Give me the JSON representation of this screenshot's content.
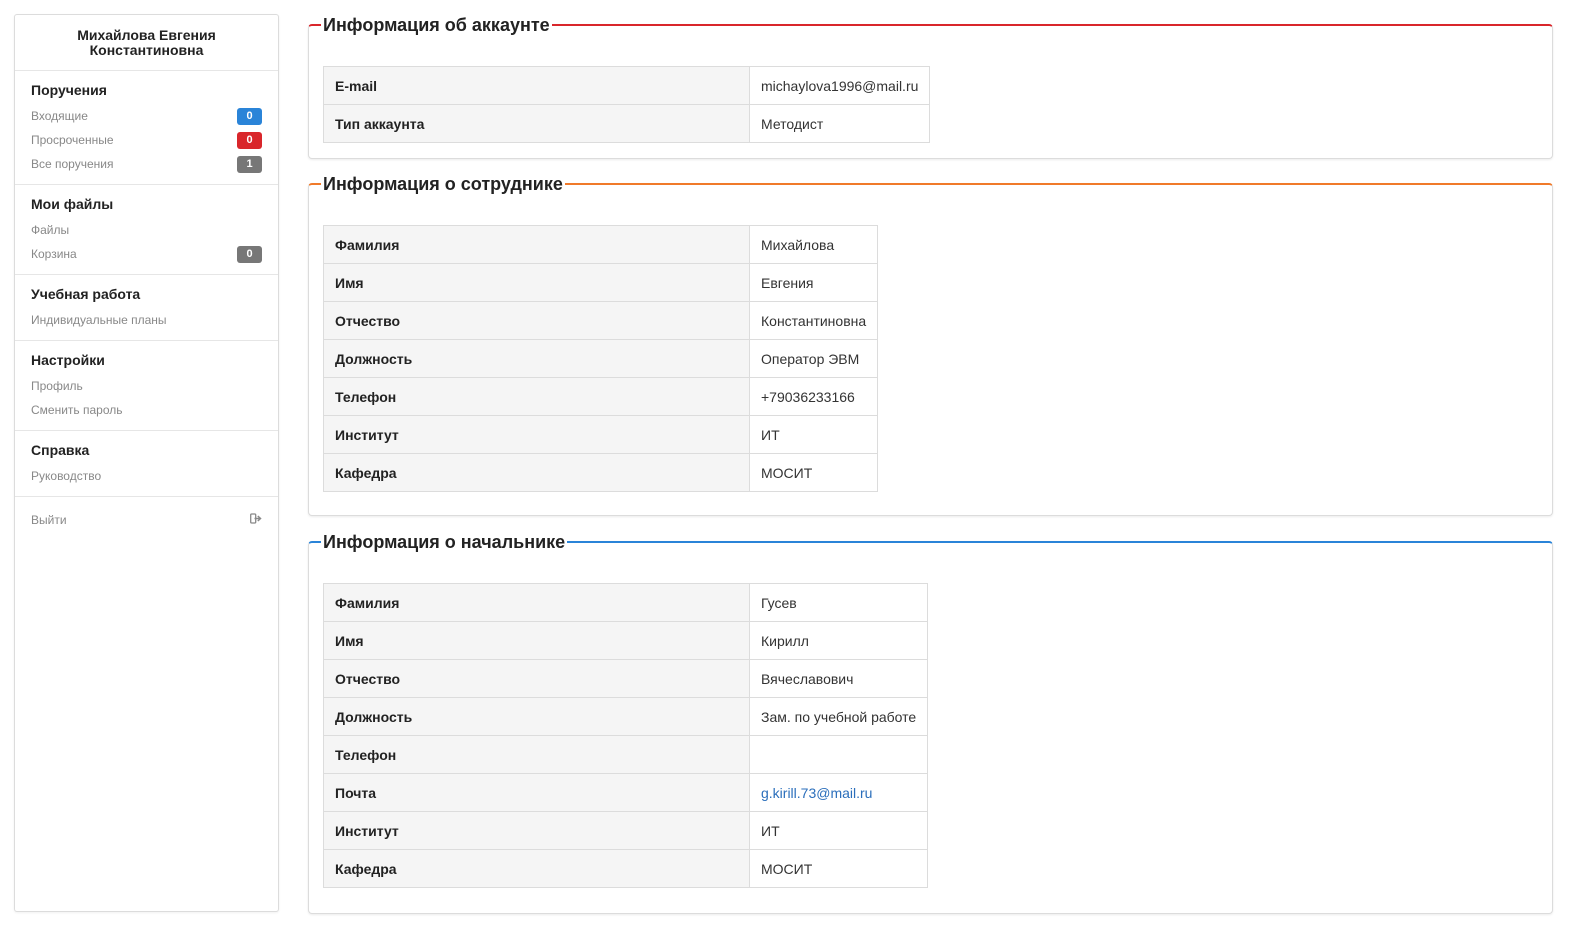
{
  "user": {
    "name_line1": "Михайлова Евгения",
    "name_line2": "Константиновна"
  },
  "sidebar": {
    "sections": [
      {
        "title": "Поручения",
        "items": [
          {
            "label": "Входящие",
            "badge": "0",
            "badge_color": "#2a84d8"
          },
          {
            "label": "Просроченные",
            "badge": "0",
            "badge_color": "#d9262b"
          },
          {
            "label": "Все поручения",
            "badge": "1",
            "badge_color": "#777777"
          }
        ]
      },
      {
        "title": "Мои файлы",
        "items": [
          {
            "label": "Файлы"
          },
          {
            "label": "Корзина",
            "badge": "0",
            "badge_color": "#777777"
          }
        ]
      },
      {
        "title": "Учебная работа",
        "items": [
          {
            "label": "Индивидуальные планы"
          }
        ]
      },
      {
        "title": "Настройки",
        "items": [
          {
            "label": "Профиль"
          },
          {
            "label": "Сменить пароль"
          }
        ]
      },
      {
        "title": "Справка",
        "items": [
          {
            "label": "Руководство"
          }
        ]
      }
    ],
    "logout": {
      "label": "Выйти",
      "icon": "sign-out-icon"
    }
  },
  "panels": {
    "account": {
      "title": "Информация об аккаунте",
      "accent": "#d9262b",
      "rows": [
        {
          "label": "E-mail",
          "value": "michaylova1996@mail.ru"
        },
        {
          "label": "Тип аккаунта",
          "value": "Методист"
        }
      ]
    },
    "employee": {
      "title": "Информация о сотруднике",
      "accent": "#f07a2a",
      "rows": [
        {
          "label": "Фамилия",
          "value": "Михайлова"
        },
        {
          "label": "Имя",
          "value": "Евгения"
        },
        {
          "label": "Отчество",
          "value": "Константиновна"
        },
        {
          "label": "Должность",
          "value": "Оператор ЭВМ"
        },
        {
          "label": "Телефон",
          "value": "+79036233166"
        },
        {
          "label": "Институт",
          "value": "ИТ"
        },
        {
          "label": "Кафедра",
          "value": "МОСИТ"
        }
      ]
    },
    "boss": {
      "title": "Информация о начальнике",
      "accent": "#2a84d8",
      "rows": [
        {
          "label": "Фамилия",
          "value": "Гусев"
        },
        {
          "label": "Имя",
          "value": "Кирилл"
        },
        {
          "label": "Отчество",
          "value": "Вячеславович"
        },
        {
          "label": "Должность",
          "value": "Зам. по учебной работе"
        },
        {
          "label": "Телефон",
          "value": ""
        },
        {
          "label": "Почта",
          "value": "g.kirill.73@mail.ru"
        },
        {
          "label": "Институт",
          "value": "ИТ"
        },
        {
          "label": "Кафедра",
          "value": "МОСИТ"
        }
      ]
    }
  }
}
